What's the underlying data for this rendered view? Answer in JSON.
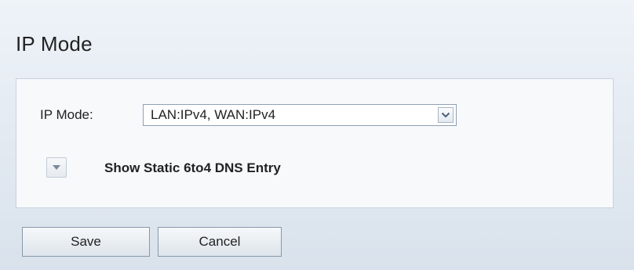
{
  "page": {
    "title": "IP Mode"
  },
  "ip_mode": {
    "label": "IP Mode:",
    "selected_value": "LAN:IPv4, WAN:IPv4"
  },
  "static_6to4": {
    "toggle_label": "Show Static 6to4 DNS Entry",
    "toggle_icon": "triangle-down-icon"
  },
  "actions": {
    "save_label": "Save",
    "cancel_label": "Cancel"
  },
  "colors": {
    "background": "#e2e9f1",
    "panel_background": "#f7f9fb",
    "panel_border": "#c9d3de",
    "select_border": "#8fa1b3",
    "button_border": "#8799ab",
    "icon_color": "#6b7f94"
  }
}
